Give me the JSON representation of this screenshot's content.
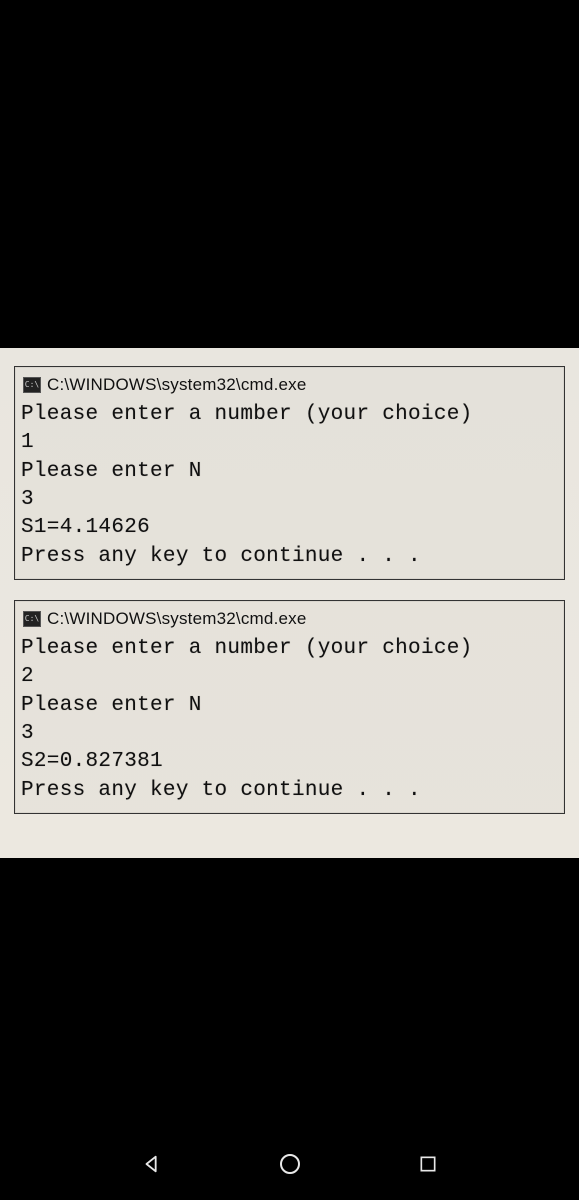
{
  "windows": [
    {
      "title": "C:\\WINDOWS\\system32\\cmd.exe",
      "lines": [
        "Please enter a number (your choice)",
        "1",
        "Please enter N",
        "3",
        "S1=4.14626",
        "Press any key to continue . . ."
      ]
    },
    {
      "title": "C:\\WINDOWS\\system32\\cmd.exe",
      "lines": [
        "Please enter a number (your choice)",
        "2",
        "Please enter N",
        "3",
        "S2=0.827381",
        "Press any key to continue . . ."
      ]
    }
  ],
  "nav": {
    "back": "back",
    "home": "home",
    "recent": "recent"
  }
}
